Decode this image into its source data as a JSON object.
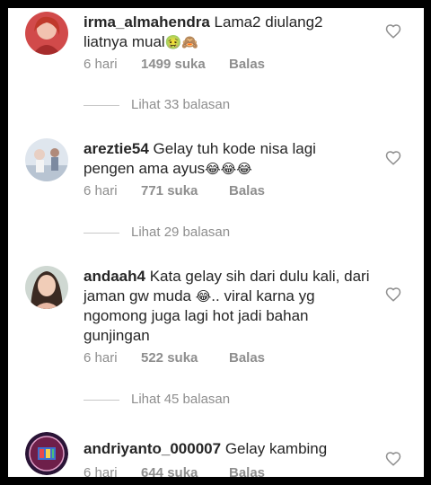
{
  "comments": [
    {
      "username": "irma_almahendra",
      "text": "Lama2 diulang2 liatnya mual",
      "emojis": "🤢🙈",
      "time": "6 hari",
      "likes": "1499 suka",
      "reply": "Balas",
      "view_replies": "Lihat 33 balasan"
    },
    {
      "username": "areztie54",
      "text": "Gelay tuh kode nisa lagi pengen ama ayus",
      "emojis": "😂😂😂",
      "time": "6 hari",
      "likes": "771 suka",
      "reply": "Balas",
      "view_replies": "Lihat 29 balasan"
    },
    {
      "username": "andaah4",
      "text_before": "Kata gelay sih dari dulu kali, dari jaman gw muda",
      "emojis": "😂",
      "text_after": ".. viral karna yg ngomong juga lagi hot jadi bahan gunjingan",
      "time": "6 hari",
      "likes": "522 suka",
      "reply": "Balas",
      "view_replies": "Lihat 45 balasan"
    },
    {
      "username": "andriyanto_000007",
      "text": "Gelay kambing",
      "time": "6 hari",
      "likes": "644 suka",
      "reply": "Balas"
    }
  ],
  "icons": {
    "like": "heart-outline-icon"
  },
  "colors": {
    "text": "#262626",
    "secondary": "#8e8e8e",
    "frame": "#000000"
  }
}
